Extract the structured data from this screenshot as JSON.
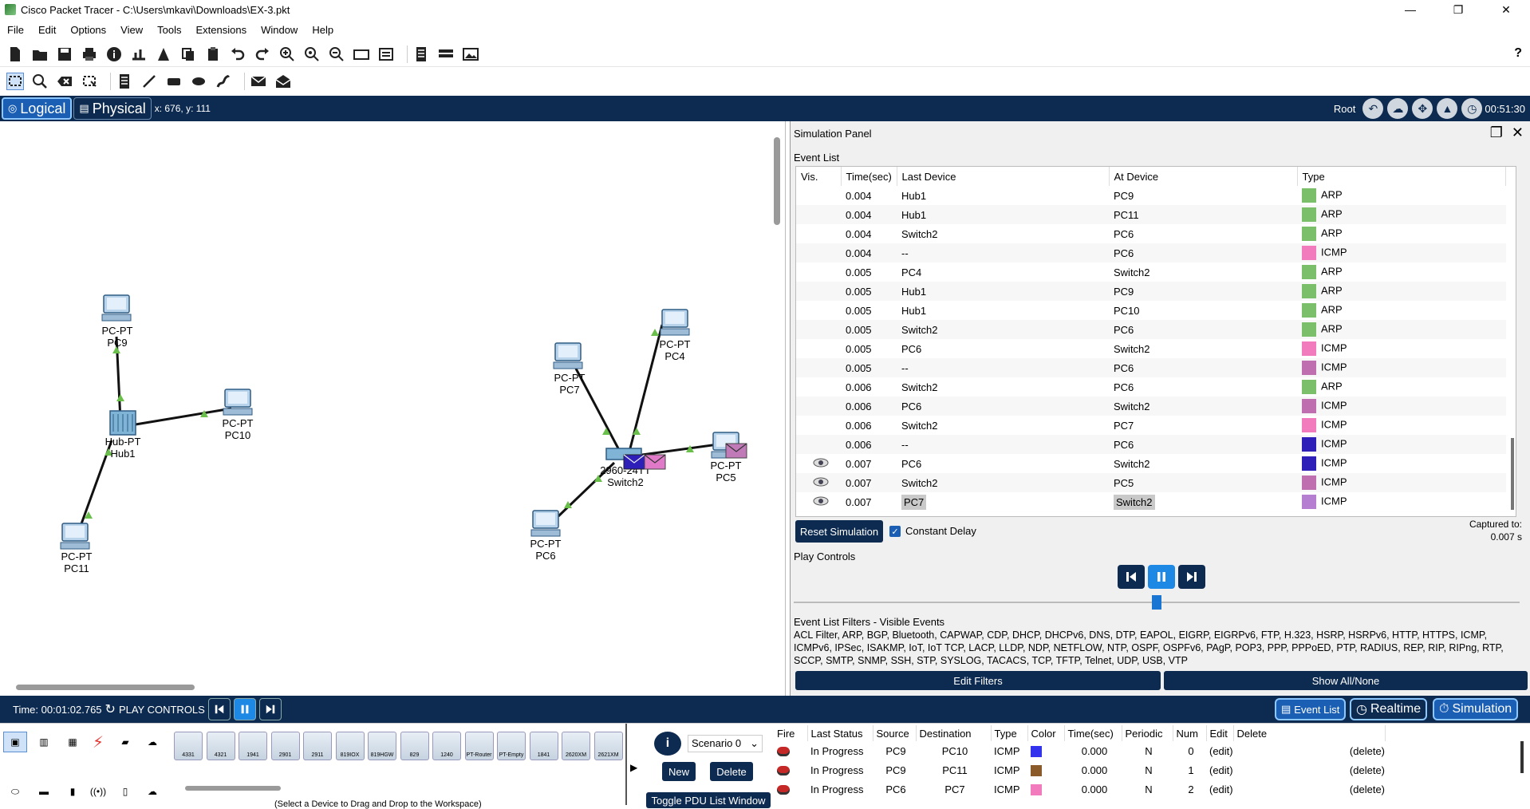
{
  "window": {
    "title": "Cisco Packet Tracer - C:\\Users\\mkavi\\Downloads\\EX-3.pkt",
    "controls": [
      "—",
      "❐",
      "✕"
    ]
  },
  "menu": [
    "File",
    "Edit",
    "Options",
    "View",
    "Tools",
    "Extensions",
    "Window",
    "Help"
  ],
  "navbar": {
    "logical": "Logical",
    "physical": "Physical",
    "coords": "x: 676, y: 111",
    "root": "Root",
    "clock": "00:51:30"
  },
  "topology": {
    "devices": [
      {
        "id": "pc9",
        "type": "PC-PT",
        "name": "PC9"
      },
      {
        "id": "hub1",
        "type": "Hub-PT",
        "name": "Hub1"
      },
      {
        "id": "pc10",
        "type": "PC-PT",
        "name": "PC10"
      },
      {
        "id": "pc11",
        "type": "PC-PT",
        "name": "PC11"
      },
      {
        "id": "pc7",
        "type": "PC-PT",
        "name": "PC7"
      },
      {
        "id": "pc4",
        "type": "PC-PT",
        "name": "PC4"
      },
      {
        "id": "switch2",
        "type": "2960-24TT",
        "name": "Switch2"
      },
      {
        "id": "pc5",
        "type": "PC-PT",
        "name": "PC5"
      },
      {
        "id": "pc6",
        "type": "PC-PT",
        "name": "PC6"
      }
    ]
  },
  "simulation": {
    "panel_title": "Simulation Panel",
    "event_list_label": "Event List",
    "columns": [
      "Vis.",
      "Time(sec)",
      "Last Device",
      "At Device",
      "Type"
    ],
    "events": [
      {
        "vis": "",
        "time": "0.004",
        "last": "Hub1",
        "at": "PC9",
        "type": "ARP",
        "color": "#7cbf6a"
      },
      {
        "vis": "",
        "time": "0.004",
        "last": "Hub1",
        "at": "PC11",
        "type": "ARP",
        "color": "#7cbf6a"
      },
      {
        "vis": "",
        "time": "0.004",
        "last": "Switch2",
        "at": "PC6",
        "type": "ARP",
        "color": "#7cbf6a"
      },
      {
        "vis": "",
        "time": "0.004",
        "last": "--",
        "at": "PC6",
        "type": "ICMP",
        "color": "#f27bbd"
      },
      {
        "vis": "",
        "time": "0.005",
        "last": "PC4",
        "at": "Switch2",
        "type": "ARP",
        "color": "#7cbf6a"
      },
      {
        "vis": "",
        "time": "0.005",
        "last": "Hub1",
        "at": "PC9",
        "type": "ARP",
        "color": "#7cbf6a"
      },
      {
        "vis": "",
        "time": "0.005",
        "last": "Hub1",
        "at": "PC10",
        "type": "ARP",
        "color": "#7cbf6a"
      },
      {
        "vis": "",
        "time": "0.005",
        "last": "Switch2",
        "at": "PC6",
        "type": "ARP",
        "color": "#7cbf6a"
      },
      {
        "vis": "",
        "time": "0.005",
        "last": "PC6",
        "at": "Switch2",
        "type": "ICMP",
        "color": "#f27bbd"
      },
      {
        "vis": "",
        "time": "0.005",
        "last": "--",
        "at": "PC6",
        "type": "ICMP",
        "color": "#bf6fb0"
      },
      {
        "vis": "",
        "time": "0.006",
        "last": "Switch2",
        "at": "PC6",
        "type": "ARP",
        "color": "#7cbf6a"
      },
      {
        "vis": "",
        "time": "0.006",
        "last": "PC6",
        "at": "Switch2",
        "type": "ICMP",
        "color": "#bf6fb0"
      },
      {
        "vis": "",
        "time": "0.006",
        "last": "Switch2",
        "at": "PC7",
        "type": "ICMP",
        "color": "#f27bbd"
      },
      {
        "vis": "",
        "time": "0.006",
        "last": "--",
        "at": "PC6",
        "type": "ICMP",
        "color": "#2d1fb8"
      },
      {
        "vis": "eye",
        "time": "0.007",
        "last": "PC6",
        "at": "Switch2",
        "type": "ICMP",
        "color": "#2d1fb8"
      },
      {
        "vis": "eye",
        "time": "0.007",
        "last": "Switch2",
        "at": "PC5",
        "type": "ICMP",
        "color": "#bf6fb0"
      },
      {
        "vis": "eye",
        "time": "0.007",
        "last": "PC7",
        "at": "Switch2",
        "type": "ICMP",
        "color": "#b57ed0",
        "selected": true
      }
    ],
    "reset_label": "Reset Simulation",
    "constant_delay": "Constant Delay",
    "captured_label": "Captured to:",
    "captured_value": "0.007 s",
    "play_controls_label": "Play Controls",
    "playback_position": 0.5,
    "filters_label": "Event List Filters - Visible Events",
    "filters_text": "ACL Filter, ARP, BGP, Bluetooth, CAPWAP, CDP, DHCP, DHCPv6, DNS, DTP, EAPOL, EIGRP, EIGRPv6, FTP, H.323, HSRP, HSRPv6, HTTP, HTTPS, ICMP, ICMPv6, IPSec, ISAKMP, IoT, IoT TCP, LACP, LLDP, NDP, NETFLOW, NTP, OSPF, OSPFv6, PAgP, POP3, PPP, PPPoED, PTP, RADIUS, REP, RIP, RIPng, RTP, SCCP, SMTP, SNMP, SSH, STP, SYSLOG, TACACS, TCP, TFTP, Telnet, UDP, USB, VTP",
    "edit_filters": "Edit Filters",
    "show_all": "Show All/None"
  },
  "bottombar": {
    "time": "Time: 00:01:02.765",
    "play_controls": "PLAY CONTROLS",
    "event_list": "Event List",
    "realtime": "Realtime",
    "simulation": "Simulation"
  },
  "devicetray": {
    "models": [
      "4331",
      "4321",
      "1941",
      "2901",
      "2911",
      "819IOX",
      "819HGW",
      "829",
      "1240",
      "PT-Router",
      "PT-Empty",
      "1841",
      "2620XM",
      "2621XM"
    ],
    "hint": "(Select a Device to Drag and Drop to the Workspace)"
  },
  "pdu": {
    "scenario": "Scenario 0",
    "new": "New",
    "delete": "Delete",
    "toggle": "Toggle PDU List Window",
    "columns": [
      "Fire",
      "Last Status",
      "Source",
      "Destination",
      "Type",
      "Color",
      "Time(sec)",
      "Periodic",
      "Num",
      "Edit",
      "Delete"
    ],
    "rows": [
      {
        "status": "In Progress",
        "source": "PC9",
        "dest": "PC10",
        "type": "ICMP",
        "color": "#3333ee",
        "time": "0.000",
        "periodic": "N",
        "num": "0",
        "edit": "(edit)",
        "delete": "(delete)"
      },
      {
        "status": "In Progress",
        "source": "PC9",
        "dest": "PC11",
        "type": "ICMP",
        "color": "#8a5a2b",
        "time": "0.000",
        "periodic": "N",
        "num": "1",
        "edit": "(edit)",
        "delete": "(delete)"
      },
      {
        "status": "In Progress",
        "source": "PC6",
        "dest": "PC7",
        "type": "ICMP",
        "color": "#f27bbd",
        "time": "0.000",
        "periodic": "N",
        "num": "2",
        "edit": "(edit)",
        "delete": "(delete)"
      }
    ]
  }
}
